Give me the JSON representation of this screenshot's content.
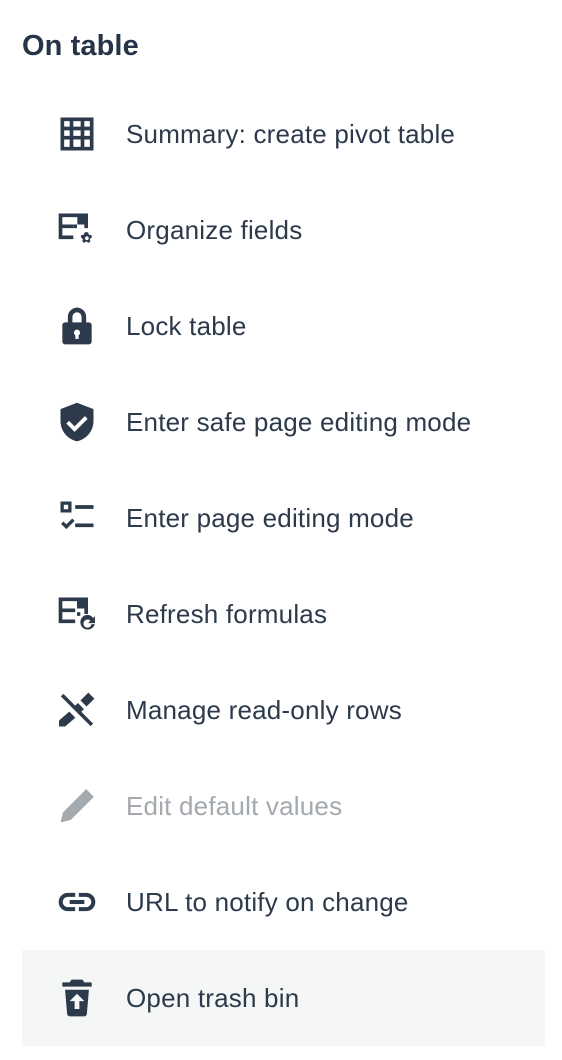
{
  "section": {
    "title": "On table"
  },
  "menu": {
    "items": [
      {
        "label": "Summary: create pivot table",
        "icon": "pivot-table-icon",
        "enabled": true
      },
      {
        "label": "Organize fields",
        "icon": "table-settings-icon",
        "enabled": true
      },
      {
        "label": "Lock table",
        "icon": "lock-icon",
        "enabled": true
      },
      {
        "label": "Enter safe page editing mode",
        "icon": "shield-check-icon",
        "enabled": true
      },
      {
        "label": "Enter page editing mode",
        "icon": "checklist-icon",
        "enabled": true
      },
      {
        "label": "Refresh formulas",
        "icon": "table-refresh-icon",
        "enabled": true
      },
      {
        "label": "Manage read-only rows",
        "icon": "pencil-off-icon",
        "enabled": true
      },
      {
        "label": "Edit default values",
        "icon": "pencil-icon",
        "enabled": false
      },
      {
        "label": "URL to notify on change",
        "icon": "link-icon",
        "enabled": true
      },
      {
        "label": "Open trash bin",
        "icon": "trash-restore-icon",
        "enabled": true,
        "hovered": true
      }
    ]
  },
  "colors": {
    "text": "#2c3a4b",
    "title": "#253446",
    "disabled": "#a4a9ae",
    "hover_background": "#f5f7f7",
    "background": "#ffffff"
  }
}
